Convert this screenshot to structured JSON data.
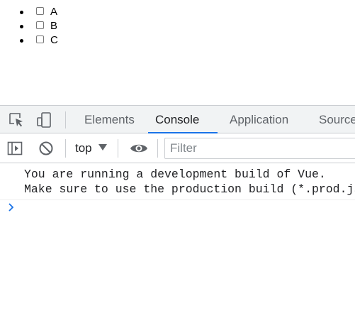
{
  "page": {
    "list_items": [
      {
        "label": "A",
        "checked": false
      },
      {
        "label": "B",
        "checked": false
      },
      {
        "label": "C",
        "checked": false
      }
    ]
  },
  "devtools": {
    "toolbar": {
      "inspect_icon": "inspect-element-icon",
      "device_icon": "device-toolbar-icon"
    },
    "tabs": [
      {
        "label": "Elements",
        "active": false
      },
      {
        "label": "Console",
        "active": true
      },
      {
        "label": "Application",
        "active": false
      },
      {
        "label": "Sources",
        "active": false
      }
    ],
    "console_toolbar": {
      "sidebar_icon": "show-console-sidebar-icon",
      "clear_icon": "clear-console-icon",
      "context": "top",
      "live_expression_icon": "eye-icon",
      "filter_placeholder": "Filter"
    },
    "messages": [
      {
        "text": "You are running a development build of Vue.\nMake sure to use the production build (*.prod.js) when deploying for production."
      }
    ],
    "prompt_icon": "chevron-right-icon"
  },
  "colors": {
    "accent": "#1a73e8",
    "toolbar_bg": "#f1f3f4",
    "border": "#cacdd1"
  }
}
